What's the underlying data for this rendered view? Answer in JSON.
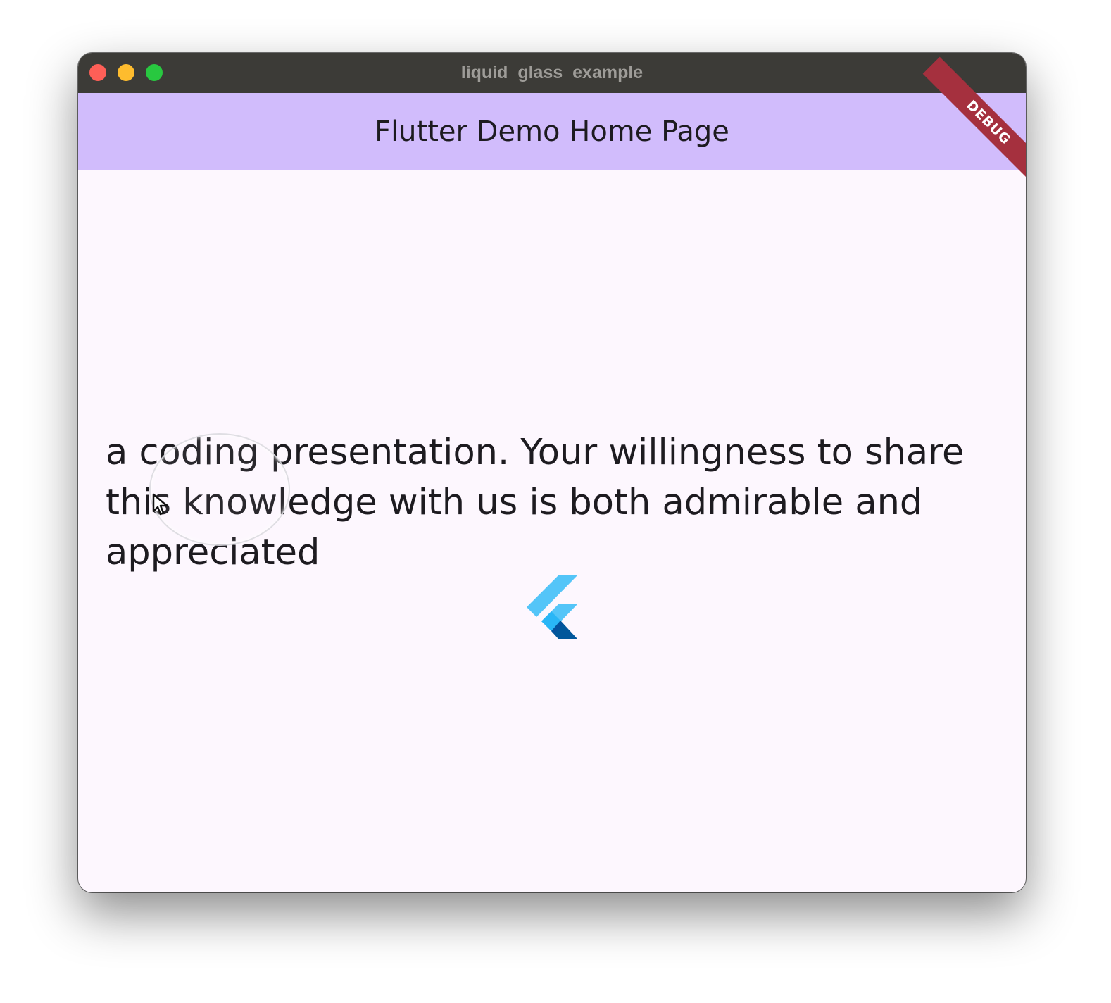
{
  "window": {
    "title": "liquid_glass_example"
  },
  "appbar": {
    "title": "Flutter Demo Home Page",
    "debug_label": "DEBUG"
  },
  "main": {
    "text": "a coding presentation. Your willingness to share this knowledge with us is both admirable and appreciated"
  },
  "icons": {
    "close": "close-button",
    "minimize": "minimize-button",
    "maximize": "maximize-button",
    "logo": "flutter-logo-icon",
    "cursor": "cursor-icon"
  },
  "colors": {
    "titlebar": "#3c3b37",
    "appbar": "#d1bcfc",
    "background": "#fdf7fe",
    "debug_banner": "#a5303e",
    "traffic_close": "#fe5f57",
    "traffic_min": "#febc2e",
    "traffic_max": "#28c840"
  }
}
